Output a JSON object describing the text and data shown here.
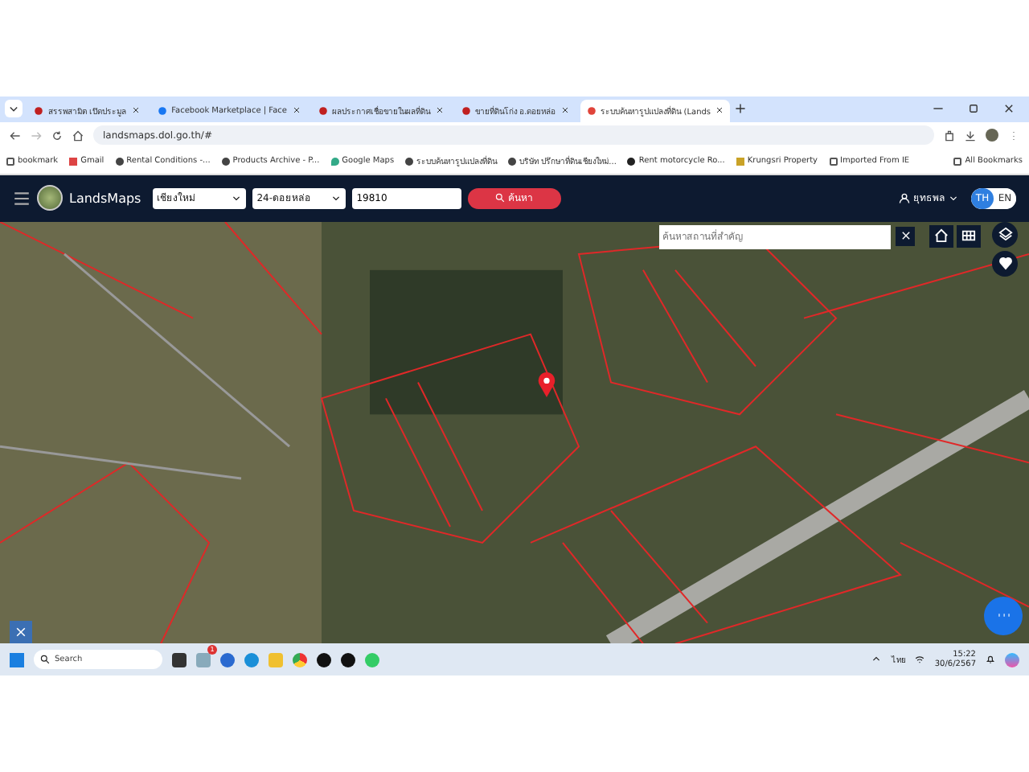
{
  "browser": {
    "tabs": [
      {
        "title": "สรรพสามิต เปิดประมูล",
        "selected": false
      },
      {
        "title": "Facebook Marketplace | Face",
        "selected": false
      },
      {
        "title": "ผลประกาศเชื่อขายในผลที่ดิน",
        "selected": false
      },
      {
        "title": "ขายที่ดินโก่ง อ.ดอยหล่อ",
        "selected": false
      },
      {
        "title": "ระบบค้นหารูปแปลงที่ดิน (Lands",
        "selected": true
      }
    ],
    "address": "landsmaps.dol.go.th/#",
    "bookmarks": [
      {
        "label": "bookmark",
        "kind": "folder"
      },
      {
        "label": "Gmail",
        "kind": "mail"
      },
      {
        "label": "Rental Conditions -...",
        "kind": "globe"
      },
      {
        "label": "Products Archive - P...",
        "kind": "globe"
      },
      {
        "label": "Google Maps",
        "kind": "pin"
      },
      {
        "label": "ระบบค้นหารูปแปลงที่ดิน",
        "kind": "globe"
      },
      {
        "label": "บริษัท ปรึกษาที่ดินเชียงใหม่...",
        "kind": "globe"
      },
      {
        "label": "Rent motorcycle Ro...",
        "kind": "dark"
      },
      {
        "label": "Krungsri Property",
        "kind": "square"
      },
      {
        "label": "Imported From IE",
        "kind": "folder"
      }
    ],
    "all_bookmarks": "All Bookmarks"
  },
  "app": {
    "brand": "LandsMaps",
    "province": "เชียงใหม่",
    "district": "24-ดอยหล่อ",
    "parcel_number": "19810",
    "search_button": "ค้นหา",
    "user": "ยุทธพล",
    "languages": [
      {
        "label": "TH",
        "selected": true
      },
      {
        "label": "EN",
        "selected": false
      }
    ],
    "place_search": {
      "placeholder": "ค้นหาสถานที่สำคัญ"
    }
  },
  "taskbar": {
    "search_placeholder": "Search",
    "notification_count": "1",
    "input_language": "ไทย",
    "time": "15:22",
    "date": "30/6/2567"
  }
}
